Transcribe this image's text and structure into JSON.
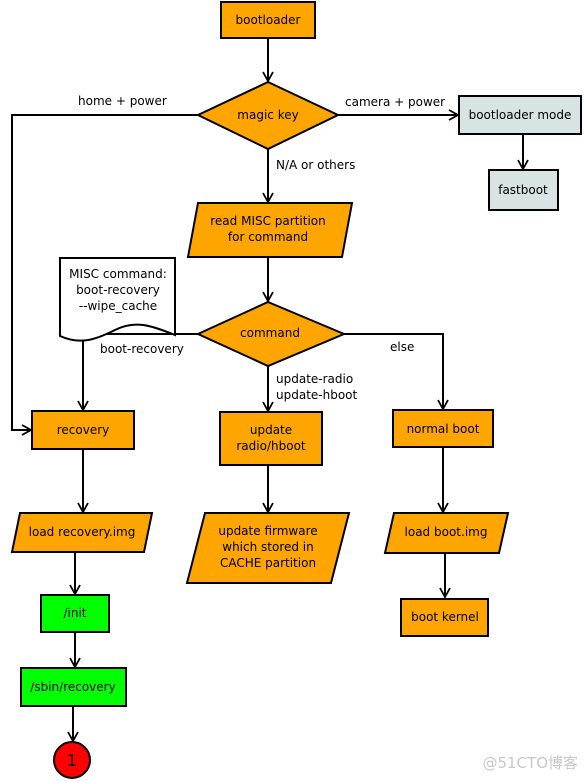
{
  "colors": {
    "process": "#ffa500",
    "mode": "#d8e4e4",
    "recovery_steps": "#00ff00",
    "connector": "#ff0000"
  },
  "nodes": {
    "bootloader": "bootloader",
    "magic_key": "magic key",
    "bootloader_mode": "bootloader mode",
    "fastboot": "fastboot",
    "read_misc": [
      "read MISC partition",
      "for command"
    ],
    "misc_note": [
      "MISC command:",
      "boot-recovery",
      "--wipe_cache"
    ],
    "command": "command",
    "recovery": "recovery",
    "update_radio": [
      "update",
      "radio/hboot"
    ],
    "normal_boot": "normal boot",
    "load_recovery": "load recovery.img",
    "update_firmware": [
      "update firmware",
      "which stored in",
      "CACHE partition"
    ],
    "load_boot": "load boot.img",
    "init": "/init",
    "sbin_recovery": "/sbin/recovery",
    "boot_kernel": "boot kernel",
    "connector": "1"
  },
  "edge_labels": {
    "home_power": "home + power",
    "camera_power": "camera + power",
    "na_others": "N/A or others",
    "boot_recovery": "boot-recovery",
    "update_radio": "update-radio",
    "update_hboot": "update-hboot",
    "else": "else"
  },
  "watermark": "@51CTO博客"
}
